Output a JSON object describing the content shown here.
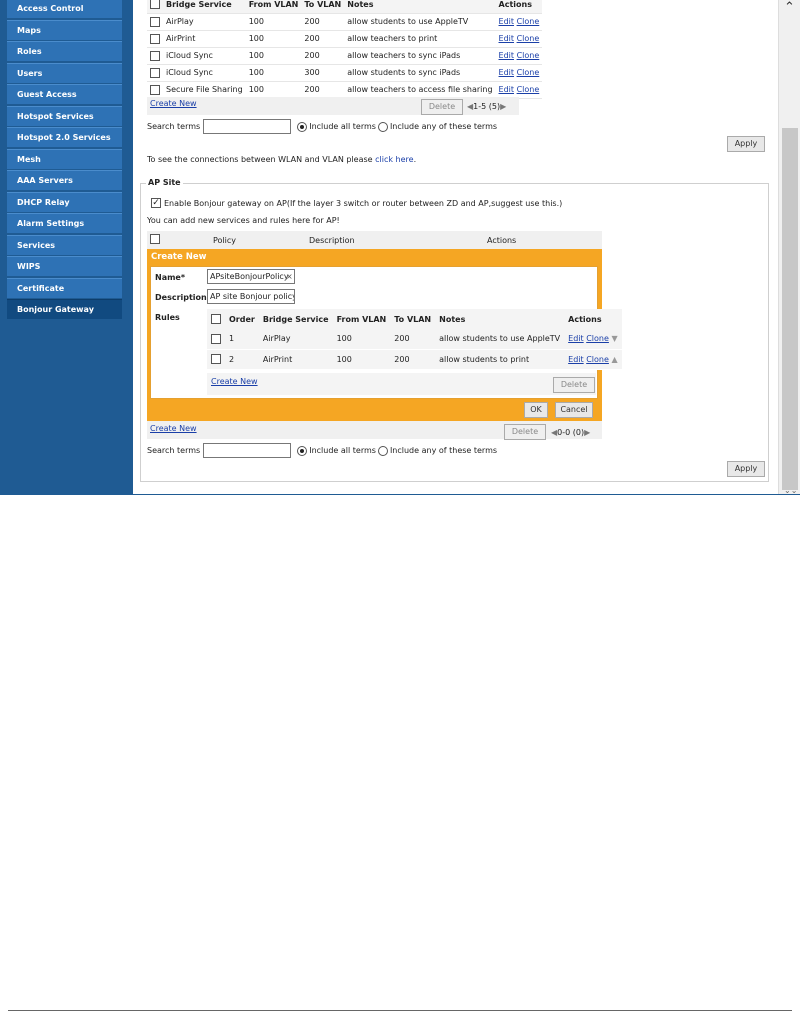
{
  "sidebar": {
    "items": [
      {
        "label": "Access Control"
      },
      {
        "label": "Maps"
      },
      {
        "label": "Roles"
      },
      {
        "label": "Users"
      },
      {
        "label": "Guest Access"
      },
      {
        "label": "Hotspot Services"
      },
      {
        "label": "Hotspot 2.0 Services"
      },
      {
        "label": "Mesh"
      },
      {
        "label": "AAA Servers"
      },
      {
        "label": "DHCP Relay"
      },
      {
        "label": "Alarm Settings"
      },
      {
        "label": "Services"
      },
      {
        "label": "WIPS"
      },
      {
        "label": "Certificate"
      },
      {
        "label": "Bonjour Gateway"
      }
    ]
  },
  "zd_rules": {
    "headers": [
      "Bridge Service",
      "From VLAN",
      "To VLAN",
      "Notes",
      "Actions"
    ],
    "rows": [
      {
        "service": "AirPlay",
        "from": "100",
        "to": "200",
        "notes": "allow students to use AppleTV"
      },
      {
        "service": "AirPrint",
        "from": "100",
        "to": "200",
        "notes": "allow teachers to print"
      },
      {
        "service": "iCloud Sync",
        "from": "100",
        "to": "200",
        "notes": "allow teachers to sync iPads"
      },
      {
        "service": "iCloud Sync",
        "from": "100",
        "to": "300",
        "notes": "allow students to sync iPads"
      },
      {
        "service": "Secure File Sharing",
        "from": "100",
        "to": "200",
        "notes": "allow teachers to access file sharing"
      }
    ],
    "edit": "Edit",
    "clone": "Clone",
    "create_new": "Create New",
    "delete": "Delete",
    "pager": "1-5 (5)",
    "search_label": "Search terms",
    "include_all": "Include all terms",
    "include_any": "Include any of these terms",
    "apply": "Apply"
  },
  "wlan_note": {
    "text": "To see the connections between WLAN and VLAN please ",
    "link": "click here",
    "suffix": "."
  },
  "ap_site": {
    "legend": "AP Site",
    "enable_label": "Enable Bonjour gateway on AP(If the layer 3 switch or router between ZD and AP,suggest use this.)",
    "enable_checked": true,
    "add_text": "You can add new services and rules here for AP!",
    "headers": [
      "Policy",
      "Description",
      "Actions"
    ],
    "create_new": {
      "title": "Create New",
      "name_label": "Name*",
      "name_value": "APsiteBonjourPolicy",
      "description_label": "Description",
      "description_value": "AP site Bonjour policy",
      "rules_label": "Rules",
      "rules_headers": [
        "Order",
        "Bridge Service",
        "From VLAN",
        "To VLAN",
        "Notes",
        "Actions"
      ],
      "rules": [
        {
          "order": "1",
          "service": "AirPlay",
          "from": "100",
          "to": "200",
          "notes": "allow students to use AppleTV"
        },
        {
          "order": "2",
          "service": "AirPrint",
          "from": "100",
          "to": "200",
          "notes": "allow students to print"
        }
      ],
      "edit": "Edit",
      "clone": "Clone",
      "rules_create_new": "Create New",
      "rules_delete": "Delete",
      "ok": "OK",
      "cancel": "Cancel"
    },
    "policy_create_new": "Create New",
    "delete": "Delete",
    "pager": "0-0 (0)",
    "search_label": "Search terms",
    "include_all": "Include all terms",
    "include_any": "Include any of these terms",
    "apply": "Apply"
  },
  "colors": {
    "sidebar": "#1f5b93",
    "sidebar_item": "#2e72b5",
    "accent": "#f5a623",
    "link": "#1a3fa8"
  }
}
